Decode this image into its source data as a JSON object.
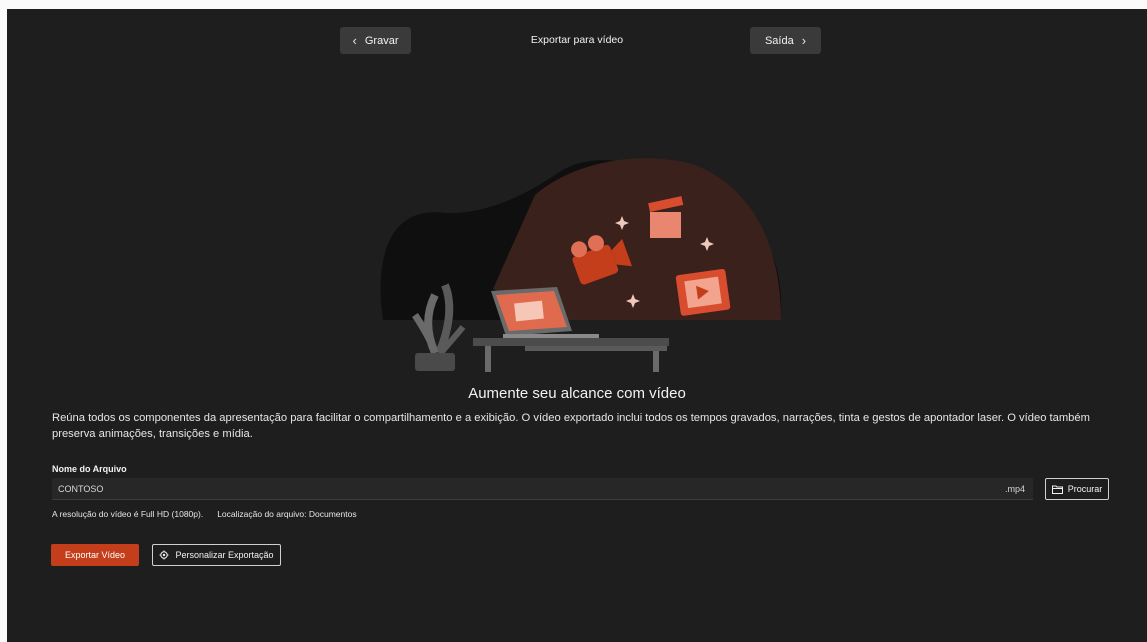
{
  "header": {
    "back_label": "Gravar",
    "title": "Exportar para vídeo",
    "next_label": "Saída"
  },
  "main": {
    "headline": "Aumente seu alcance com vídeo",
    "description": "Reúna todos os componentes da apresentação para facilitar o compartilhamento e a exibição. O vídeo exportado inclui todos os tempos gravados, narrações, tinta e gestos de apontador laser. O vídeo também preserva animações, transições e mídia."
  },
  "file": {
    "label": "Nome do Arquivo",
    "value": "CONTOSO",
    "extension": ".mp4",
    "browse_label": "Procurar",
    "resolution_text": "A resolução do vídeo é Full HD (1080p).",
    "location_text": "Localização do arquivo: Documentos"
  },
  "actions": {
    "export_label": "Exportar Vídeo",
    "customize_label": "Personalizar Exportação"
  },
  "icons": {
    "back": "chevron-left-icon",
    "next": "chevron-right-icon",
    "browse": "folder-icon",
    "customize": "settings-icon"
  },
  "colors": {
    "background": "#1e1e1e",
    "accent": "#c43e1c",
    "button": "#3a3a3a"
  }
}
